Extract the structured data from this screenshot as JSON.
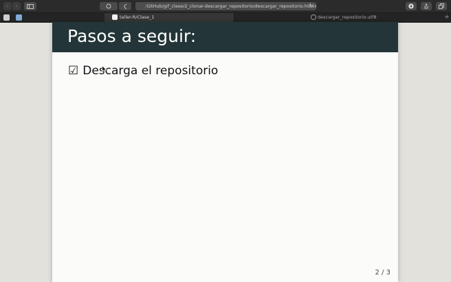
{
  "browser": {
    "address": {
      "url_prefix": "/",
      "url_text": "GitHub/gif_clase/2_clonar-descargar_repositorio/descargar_repositorio.html#2"
    },
    "tabs": [
      {
        "title": "taller-R/Clase_1",
        "active": true,
        "favicon": "github-icon"
      },
      {
        "title": "descargar_repositorio.utf8",
        "active": false,
        "favicon": "globe-icon"
      }
    ],
    "new_tab_label": "+"
  },
  "slide": {
    "title": "Pasos a seguir:",
    "bullet_check": "☑",
    "bullet_text": "Descarga el repositorio",
    "page_number": "2 / 3"
  },
  "colors": {
    "header": "#233538",
    "slide_bg": "#fbfbfa",
    "desktop_bg": "#e2e1dc",
    "toolbar": "#2b2b2c"
  }
}
